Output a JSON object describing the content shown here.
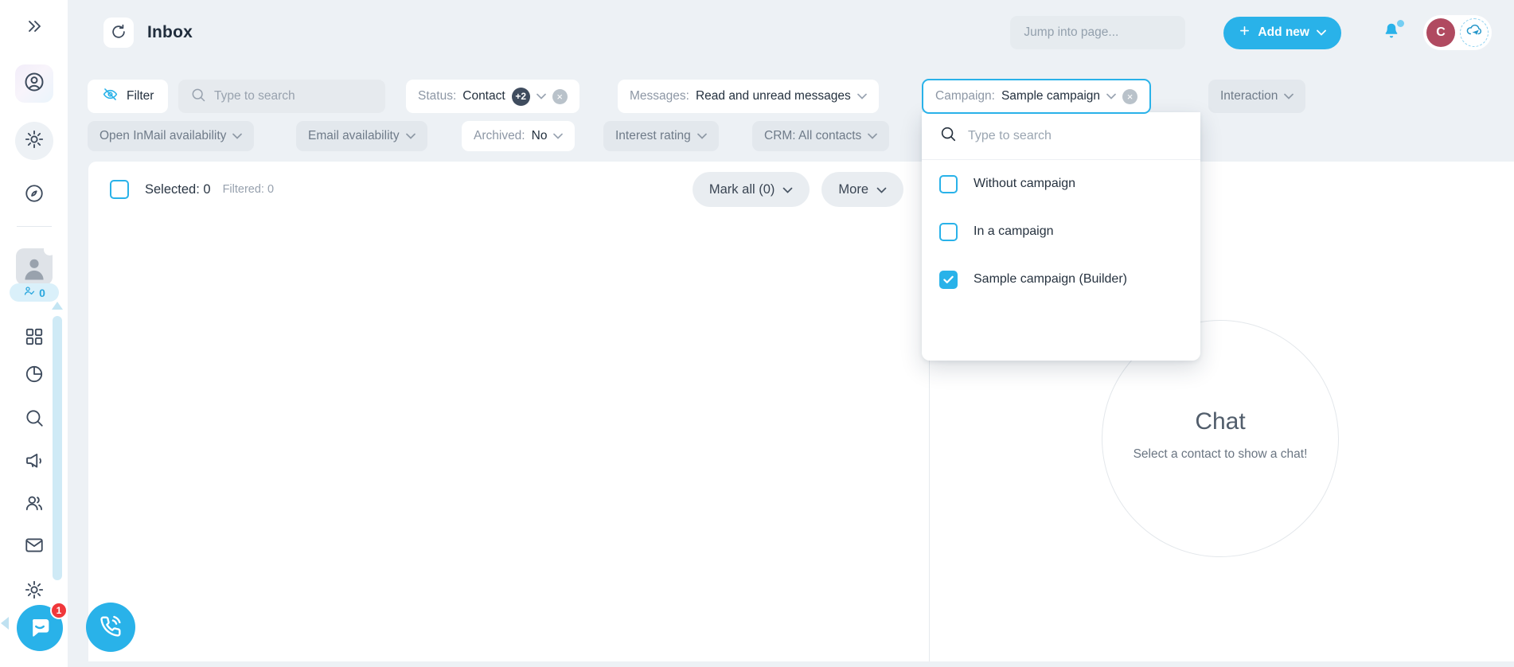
{
  "colors": {
    "accent": "#29b2e9",
    "accent_dark": "#2596c9",
    "avatar": "#b04a60",
    "badge_dark": "#3f4c5e",
    "danger": "#f0383b"
  },
  "sidebar": {
    "contacts_badge": "0",
    "widget_badge": "1"
  },
  "header": {
    "title": "Inbox",
    "jump_placeholder": "Jump into page...",
    "add_new": "Add new",
    "avatar_initial": "C"
  },
  "filters": {
    "filter_button": "Filter",
    "search_placeholder": "Type to search",
    "status": {
      "label": "Status:",
      "value": "Contact",
      "extra": "+2"
    },
    "messages": {
      "label": "Messages:",
      "value": "Read and unread messages"
    },
    "campaign": {
      "label": "Campaign:",
      "value": "Sample campaign"
    },
    "interaction": "Interaction",
    "row2": [
      {
        "label": "Open InMail availability"
      },
      {
        "label": "Email availability"
      },
      {
        "label": "Archived:",
        "value": "No"
      },
      {
        "label": "Interest rating"
      },
      {
        "label": "CRM: All contacts"
      }
    ]
  },
  "toolbar": {
    "selected": "Selected: 0",
    "filtered": "Filtered: 0",
    "mark_all": "Mark all (0)",
    "more": "More"
  },
  "campaign_dropdown": {
    "search_placeholder": "Type to search",
    "options": [
      {
        "label": "Without campaign",
        "checked": false
      },
      {
        "label": "In a campaign",
        "checked": false
      },
      {
        "label": "Sample campaign (Builder)",
        "checked": true
      }
    ]
  },
  "chat": {
    "title": "Chat",
    "subtitle": "Select a contact to show a chat!"
  }
}
